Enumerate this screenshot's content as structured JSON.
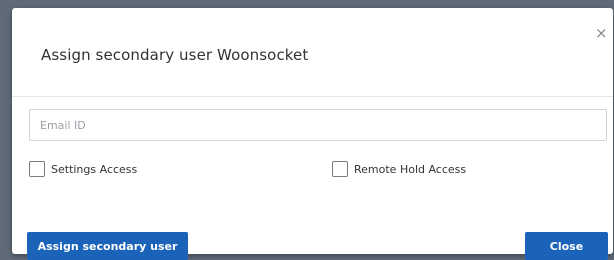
{
  "dialog": {
    "title": "Assign secondary user Woonsocket",
    "close_glyph": "×",
    "email": {
      "placeholder": "Email ID",
      "value": ""
    },
    "checkboxes": [
      {
        "label": "Settings Access",
        "checked": false
      },
      {
        "label": "Remote Hold Access",
        "checked": false
      }
    ],
    "assign_button_label": "Assign secondary user",
    "close_button_label": "Close"
  },
  "colors": {
    "primary_button": "#1a63b8",
    "backdrop": "#5f6b78"
  },
  "icons": {
    "close": "close-icon"
  }
}
